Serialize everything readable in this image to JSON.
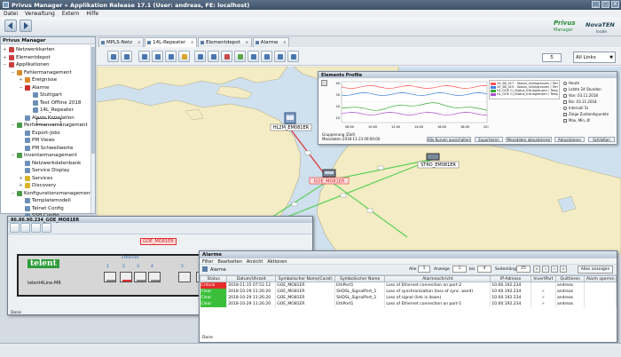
{
  "window": {
    "title": "Privus Manager » Applikation Release 17.1 (User: andreas, FE: localhost)",
    "min": "_",
    "max": "□",
    "close": "×"
  },
  "menu": [
    "Datei",
    "Verwaltung",
    "Extern",
    "Hilfe"
  ],
  "logo": {
    "brand": "Privus",
    "brand2": "Manager",
    "product": "NovaTEN",
    "sub": "Inside"
  },
  "tree": {
    "header": "Privus Manager",
    "items": [
      {
        "label": "Netzwerkkarten",
        "expander": "+",
        "color": "#c94040"
      },
      {
        "label": "Elementdepot",
        "expander": "+",
        "color": "#c94040"
      },
      {
        "label": "Applikationen",
        "expander": "−",
        "color": "#c94040"
      },
      {
        "label": "Fehlermanagement",
        "expander": "−",
        "color": "#d98a2b"
      },
      {
        "label": "Ereignisse",
        "expander": "+",
        "color": "#d98a2b"
      },
      {
        "label": "Alarme",
        "expander": "−",
        "color": "#d03030"
      },
      {
        "label": "Stuttgart",
        "expander": "",
        "color": "#6c8fb8"
      },
      {
        "label": "Test Offline 2018",
        "expander": "",
        "color": "#6c8fb8"
      },
      {
        "label": "14L_Repeater",
        "expander": "",
        "color": "#6c8fb8"
      },
      {
        "label": "Alarm Korrelation",
        "expander": "",
        "color": "#6c8fb8"
      },
      {
        "label": "Performancemanagement",
        "expander": "−",
        "color": "#4b9a4b"
      },
      {
        "label": "Export-Jobs",
        "expander": "",
        "color": "#6c8fb8"
      },
      {
        "label": "PM Views",
        "expander": "",
        "color": "#6c8fb8"
      },
      {
        "label": "PM Schwellwerte",
        "expander": "",
        "color": "#6c8fb8"
      },
      {
        "label": "Inventarmanagement",
        "expander": "−",
        "color": "#4b9a4b"
      },
      {
        "label": "Netzwerkdatenbank",
        "expander": "",
        "color": "#6c8fb8"
      },
      {
        "label": "Service Display",
        "expander": "",
        "color": "#6c8fb8"
      },
      {
        "label": "Services",
        "expander": "+",
        "color": "#d9b32b"
      },
      {
        "label": "Discovery",
        "expander": "+",
        "color": "#d9b32b"
      },
      {
        "label": "Konfigurationsmanagement",
        "expander": "−",
        "color": "#4b9a4b"
      },
      {
        "label": "Templatemodell",
        "expander": "",
        "color": "#6c8fb8"
      },
      {
        "label": "Telnet Config",
        "expander": "",
        "color": "#6c8fb8"
      },
      {
        "label": "SSH Config",
        "expander": "",
        "color": "#6c8fb8"
      }
    ]
  },
  "tabs": [
    "MPLS-Netz",
    "14L-Repeater",
    "Elementdepot",
    "Alarme"
  ],
  "toolbar": {
    "page": "5",
    "link_filter": "All Links"
  },
  "map": {
    "nodes": {
      "n1": "HL2M_EM081ER",
      "n2": "GOE_MO81ER",
      "n3": "STRO_EM081ER"
    }
  },
  "perf": {
    "title": "Elements Profile",
    "legend": [
      "29_SB_017 - Status_Inlinkgrenzen / Temperatur 1 °C",
      "29_SB_015 - Status_Inlinkgrenzen / Temperatur 1 °C",
      "HL_GOE Cl_Status_Inlinkgrenzen / Temperatur 1 °C",
      "HL_GOE Cl_Status_Inlinkgrenzen / Temperatur 1 °C"
    ],
    "options": [
      "Heute",
      "Letzte 24 Stunden",
      "Von: 03.11.2018",
      "Bis: 03.11.2018",
      "Intervall 5s",
      "Zeige Zustandspunkte",
      "Max, Min, Ø"
    ],
    "buttons": [
      "Alle Kurven ausschalten",
      "Exportieren",
      "Messdaten aktualisieren",
      "Aktualisieren",
      "Schließen"
    ],
    "checks": [
      "Gruppierung (Zeit)",
      "Messdaten 2018-11-23 09:00:00"
    ],
    "series_colors": [
      "#ff5555",
      "#3f7fe0",
      "#33aa33",
      "#aa55cc"
    ],
    "ylabels": [
      "40",
      "30",
      "20",
      "10"
    ],
    "xlabels": [
      "08:00",
      "10:00",
      "12:00",
      "14:00",
      "16:00",
      "18:00",
      "20:00"
    ]
  },
  "detail": {
    "title": "86.86.90.234_GOE_MO81ER",
    "node_label": "GOE_MO81ER",
    "brand": "telent",
    "model": "telent4Line-MR",
    "group": "Ethernet",
    "port_numbers": [
      "1",
      "2",
      "3",
      "4",
      "5",
      "1"
    ],
    "status": "Done"
  },
  "alarms": {
    "title": "Alarme",
    "menu": [
      "Filter",
      "Bearbeiten",
      "Ansicht",
      "Aktionen"
    ],
    "toolbar_label": "Alarme",
    "all_label": "Alle",
    "all_count": "1",
    "anz_label": "Anzeige",
    "anz_value": "1",
    "bis_label": "bis",
    "bis_value": "4",
    "seiten_label": "Seitenlänge",
    "seiten_value": "25",
    "ack_button": "Alles anzeigen",
    "columns": [
      "Status",
      "Datum/Uhrzeit",
      "Symbolischer Name(Carat)",
      "Symbolischer Name",
      "Alarmnachricht",
      "IP-Adresse",
      "InvertPart",
      "Quittieren",
      "Alarm sperren"
    ],
    "rows": [
      [
        "Critical",
        "2018-11-15 07:51:12",
        "GOE_MO81ER",
        "EthPort1",
        "Loss of Ethernet connection on port-2",
        "10.60.192.234",
        "",
        "andreas",
        ""
      ],
      [
        "Clear",
        "2018-10-29 11:26:20",
        "GOE_MO81ER",
        "SHDSL_SignalPort_1",
        "Loss of synchronization (loss of sync. word)",
        "10.60.192.234",
        "✓",
        "andreas",
        ""
      ],
      [
        "Clear",
        "2018-10-29 11:26:20",
        "GOE_MO81ER",
        "SHDSL_SignalPort_1",
        "Loss of signal (link is down)",
        "10.60.192.234",
        "✓",
        "andreas",
        ""
      ],
      [
        "Clear",
        "2018-10-29 11:26:20",
        "GOE_MO81ER",
        "EthPort1",
        "Loss of Ethernet connection on port-1",
        "10.60.192.234",
        "✓",
        "andreas",
        ""
      ]
    ],
    "status_colors": {
      "Critical": "#e52b2b",
      "Clear": "#3bbf3b"
    },
    "status": "Done"
  }
}
